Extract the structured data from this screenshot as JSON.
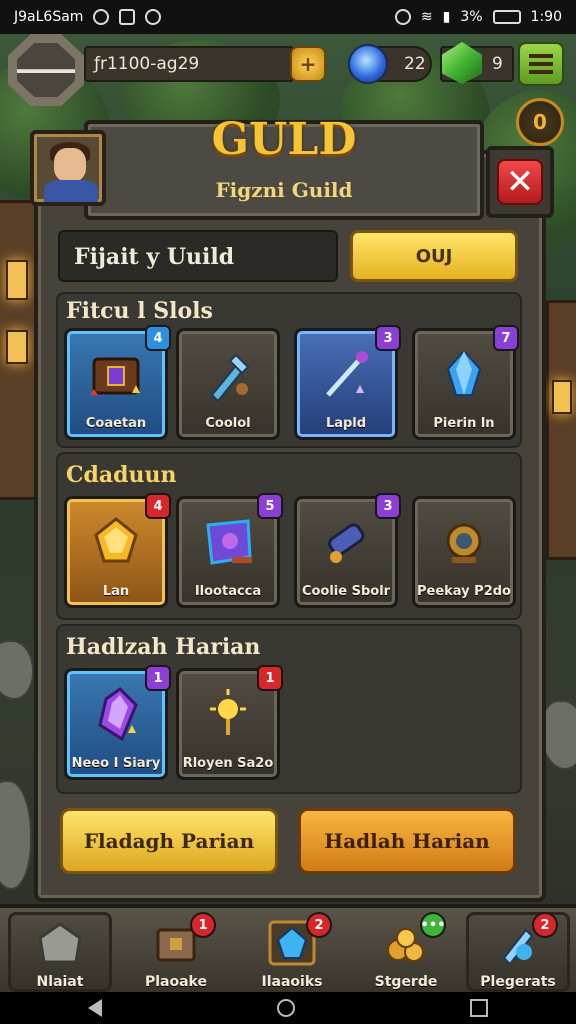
{
  "status_bar": {
    "left_text": "J9aL6Sam",
    "battery": "3%",
    "time": "1:90"
  },
  "hud": {
    "player_id": "ƒr1100-ag29",
    "orb_count": "22",
    "gem_count": "9",
    "timer_label": "0"
  },
  "header": {
    "title": "GULD",
    "subtitle": "Figzni Guild"
  },
  "search": {
    "value": "Fijait y Uuild",
    "button_label": "OUJ"
  },
  "sections": [
    {
      "title": "Fitcu l Slols",
      "items": [
        {
          "label": "Coaetan",
          "badge": "4",
          "badge_color": "blue",
          "style": "blue",
          "icon": "chest-icon"
        },
        {
          "label": "Coolol",
          "badge": "",
          "badge_color": "",
          "style": "dark",
          "icon": "sword-icon"
        },
        {
          "label": "Lapld",
          "badge": "3",
          "badge_color": "purple",
          "style": "purple-blue",
          "icon": "staff-icon"
        },
        {
          "label": "Pierin ln",
          "badge": "7",
          "badge_color": "purple",
          "style": "dark",
          "icon": "crystal-icon"
        }
      ]
    },
    {
      "title": "Cdaduun",
      "items": [
        {
          "label": "Lan",
          "badge": "4",
          "badge_color": "red",
          "style": "gold",
          "icon": "gold-gem-icon"
        },
        {
          "label": "Ilootacca",
          "badge": "5",
          "badge_color": "purple",
          "style": "dark",
          "icon": "scroll-card-icon"
        },
        {
          "label": "Coolie Sbolr",
          "badge": "3",
          "badge_color": "purple",
          "style": "dark",
          "icon": "cannon-icon"
        },
        {
          "label": "Peekay P2do",
          "badge": "",
          "badge_color": "",
          "style": "dark",
          "icon": "amulet-icon"
        }
      ]
    },
    {
      "title": "Hadlzah Harian",
      "items": [
        {
          "label": "Neeo I Siary",
          "badge": "1",
          "badge_color": "purple",
          "style": "blue",
          "icon": "purple-crystal-icon"
        },
        {
          "label": "Rloyen Sa2o",
          "badge": "1",
          "badge_color": "red",
          "style": "dark",
          "icon": "sun-orb-icon"
        }
      ]
    }
  ],
  "buttons": {
    "left": "Fladagh Parian",
    "right": "Hadlah Harian"
  },
  "nav": [
    {
      "label": "Nlaiat",
      "badge": "",
      "icon": "house-icon"
    },
    {
      "label": "Plaoake",
      "badge": "1",
      "icon": "chest-icon"
    },
    {
      "label": "Ilaaoiks",
      "badge": "2",
      "icon": "blue-gem-icon"
    },
    {
      "label": "Stgerde",
      "badge": "•••",
      "icon": "coins-icon"
    },
    {
      "label": "Plegerats",
      "badge": "2",
      "icon": "sword-gem-icon"
    }
  ],
  "colors": {
    "title_gold": "#f5c434",
    "badge_red": "#d9262a",
    "badge_purple": "#8c3fd6",
    "accent_yellow": "#ffe56a"
  }
}
